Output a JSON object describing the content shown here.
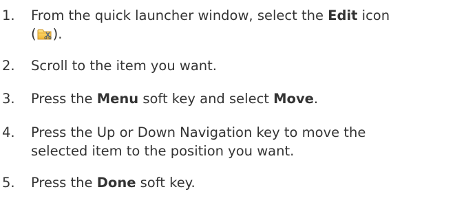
{
  "steps": [
    {
      "number": "1.",
      "line1_before": "From the quick launcher window, select the ",
      "line1_bold": "Edit",
      "line1_after": " icon",
      "line2_before": "(",
      "line2_icon": "folder-edit-icon",
      "line2_after": ")."
    },
    {
      "number": "2.",
      "text": "Scroll to the item you want."
    },
    {
      "number": "3.",
      "before": "Press the ",
      "bold1": "Menu",
      "middle": " soft key and select ",
      "bold2": "Move",
      "after": "."
    },
    {
      "number": "4.",
      "line1": "Press the Up or Down Navigation key to move the",
      "line2": "selected item to the position you want."
    },
    {
      "number": "5.",
      "before": "Press the ",
      "bold": "Done",
      "after": " soft key."
    }
  ]
}
